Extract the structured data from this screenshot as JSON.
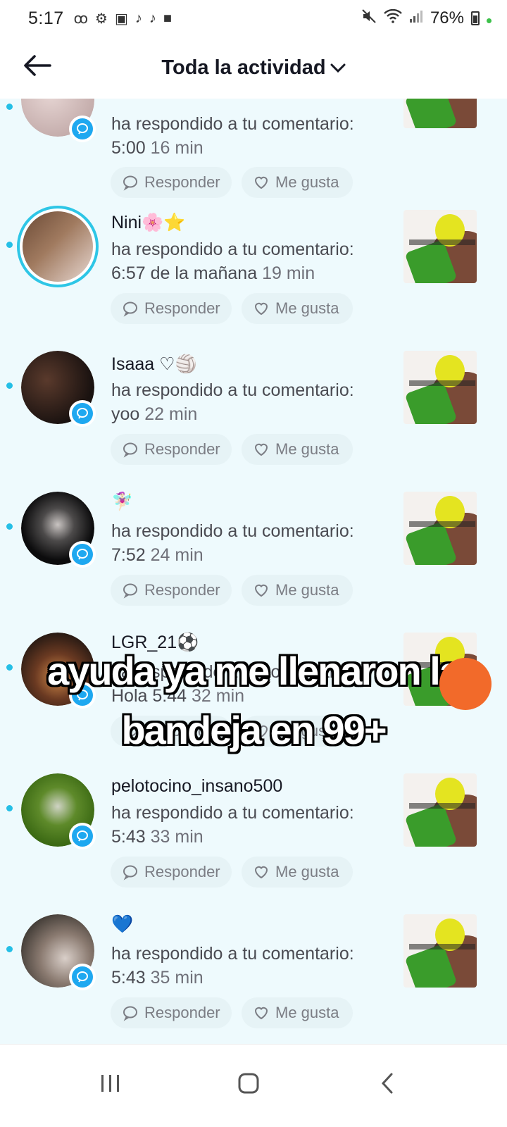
{
  "status_bar": {
    "time": "5:17",
    "battery": "76%"
  },
  "header": {
    "title": "Toda la actividad"
  },
  "actions": {
    "reply": "Responder",
    "like": "Me gusta"
  },
  "items": [
    {
      "username": "",
      "line1": "ha respondido a tu comentario:",
      "comment": "5:00",
      "time": "16 min"
    },
    {
      "username": "Nini🌸⭐",
      "line1": "ha respondido a tu comentario:",
      "comment": "6:57 de la mañana",
      "time": "19 min"
    },
    {
      "username": "Isaaa ♡🏐",
      "line1": "ha respondido a tu comentario:",
      "comment": "yoo",
      "time": "22 min"
    },
    {
      "username": "🧚🏻‍♀️",
      "line1": "ha respondido a tu comentario:",
      "comment": "7:52",
      "time": "24 min"
    },
    {
      "username": "LGR_21⚽",
      "line1": "ha respondido a tu comentario:",
      "comment": "Hola 5:44",
      "time": "32 min"
    },
    {
      "username": "pelotocino_insano500",
      "line1": "ha respondido a tu comentario:",
      "comment": "5:43",
      "time": "33 min"
    },
    {
      "username": "💙",
      "line1": "ha respondido a tu comentario:",
      "comment": "5:43",
      "time": "35 min"
    }
  ],
  "overlay": {
    "line1": "ayuda ya me llenaron la",
    "line2": "bandeja en 99+"
  },
  "colors": {
    "list_bg": "#eefafd",
    "unread": "#25bfe6",
    "badge": "#1ea8f0",
    "pill_bg": "#e6f3f6"
  },
  "icons": [
    "back-arrow-icon",
    "chevron-down-icon",
    "comment-badge-icon",
    "reply-icon",
    "heart-icon",
    "recents-icon",
    "home-icon",
    "back-nav-icon"
  ]
}
